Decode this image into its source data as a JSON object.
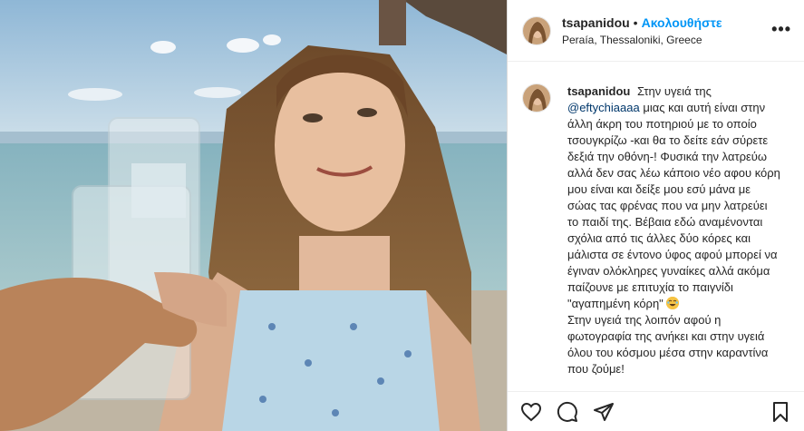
{
  "post": {
    "username": "tsapanidou",
    "dot": "•",
    "follow_label": "Ακολουθήστε",
    "location": "Peraía, Thessaloniki, Greece",
    "more_label": "•••",
    "caption": {
      "text_1": "Στην υγειά της",
      "mention": "@eftychiaaaa",
      "text_2": "μιας και αυτή είναι στην άλλη άκρη του ποτηριού με το οποίο τσουγκρίζω -και θα το δείτε εάν σύρετε δεξιά την οθόνη-! Φυσικά την λατρεύω αλλά δεν σας λέω κάποιο νέο αφου κόρη μου είναι και δείξε μου εσύ μάνα με σώας τας φρένας που να μην λατρεύει το παιδί της. Βέβαια εδώ αναμένονται σχόλια από τις άλλες δύο κόρες και μάλιστα σε έντονο ύφος αφού μπορεί να έγιναν ολόκληρες γυναίκες αλλά ακόμα παίζουνε με επιτυχία το παιγνίδι \"αγαπημένη κόρη\"",
      "emoji": "laughing-emoji",
      "text_3": "Στην υγειά της λοιπόν αφού η φωτογραφία της ανήκει και στην υγειά όλου του κόσμου μέσα στην καραντίνα που ζούμε!"
    }
  },
  "actions": {
    "like_icon": "heart-icon",
    "comment_icon": "comment-icon",
    "share_icon": "share-icon",
    "save_icon": "bookmark-icon"
  }
}
